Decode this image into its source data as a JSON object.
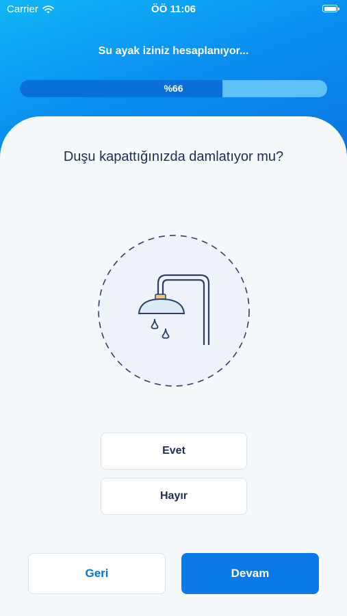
{
  "status_bar": {
    "carrier": "Carrier",
    "time": "ÖÖ 11:06"
  },
  "progress": {
    "title": "Su ayak iziniz hesaplanıyor...",
    "label": "%66",
    "value": 0.66
  },
  "question": {
    "text": "Duşu kapattığınızda damlatıyor mu?",
    "illustration_icon": "shower-head-icon"
  },
  "answers": [
    {
      "label": "Evet"
    },
    {
      "label": "Hayır"
    }
  ],
  "navigation": {
    "back_label": "Geri",
    "next_label": "Devam"
  },
  "colors": {
    "accent": "#0a7ae8",
    "text": "#1d2d50",
    "background": "#f5f9fc"
  }
}
